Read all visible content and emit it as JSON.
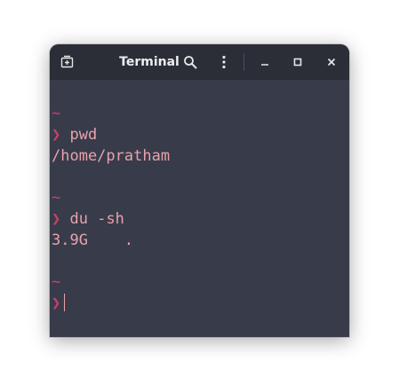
{
  "titlebar": {
    "title": "Terminal",
    "icons": [
      "new-tab-icon",
      "search-icon",
      "menu-icon",
      "minimize-icon",
      "maximize-icon",
      "close-icon"
    ]
  },
  "terminal": {
    "tilde": "~",
    "prompt_symbol": "❯",
    "entries": [
      {
        "command": "pwd",
        "output": "/home/pratham"
      },
      {
        "command": "du -sh",
        "output_size": "3.9G",
        "output_path": "."
      }
    ]
  },
  "colors": {
    "background": "#383c4a",
    "titlebar": "#2b2e37",
    "accent": "#c9416a",
    "text": "#e8a1ad"
  }
}
